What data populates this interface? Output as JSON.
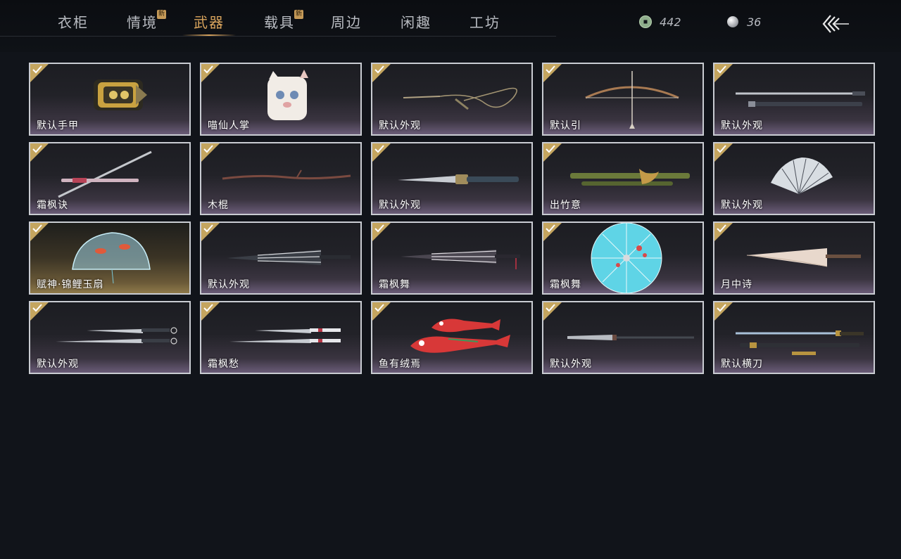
{
  "tabs": [
    {
      "label": "衣柜",
      "active": false,
      "badge": ""
    },
    {
      "label": "情境",
      "active": false,
      "badge": "新"
    },
    {
      "label": "武器",
      "active": true,
      "badge": ""
    },
    {
      "label": "载具",
      "active": false,
      "badge": "新"
    },
    {
      "label": "周边",
      "active": false,
      "badge": ""
    },
    {
      "label": "闲趣",
      "active": false,
      "badge": ""
    },
    {
      "label": "工坊",
      "active": false,
      "badge": ""
    }
  ],
  "currency": [
    {
      "icon": "jade-coin-icon",
      "value": "442"
    },
    {
      "icon": "pearl-icon",
      "value": "36"
    }
  ],
  "back_icon": "back-arrow-icon",
  "colors": {
    "accent": "#d9a45d",
    "check": "#c4a55f",
    "border": "#c9ccd2"
  },
  "items": [
    {
      "name": "默认手甲",
      "icon": "gauntlet-icon",
      "equipped": true
    },
    {
      "name": "喵仙人掌",
      "icon": "cat-paw-icon",
      "equipped": true
    },
    {
      "name": "默认外观",
      "icon": "rope-dart-icon",
      "equipped": true
    },
    {
      "name": "默认引",
      "icon": "bow-icon",
      "equipped": true
    },
    {
      "name": "默认外观",
      "icon": "sword-icon",
      "equipped": true
    },
    {
      "name": "霜枫诀",
      "icon": "spear-icon",
      "equipped": true
    },
    {
      "name": "木棍",
      "icon": "staff-icon",
      "equipped": true
    },
    {
      "name": "默认外观",
      "icon": "dagger-icon",
      "equipped": true
    },
    {
      "name": "出竹意",
      "icon": "bamboo-icon",
      "equipped": true
    },
    {
      "name": "默认外观",
      "icon": "fan-icon",
      "equipped": true
    },
    {
      "name": "赋神·锦鲤玉扇",
      "icon": "carp-fan-icon",
      "equipped": true
    },
    {
      "name": "默认外观",
      "icon": "closed-umbrella-icon",
      "equipped": true
    },
    {
      "name": "霜枫舞",
      "icon": "closed-umbrella-icon",
      "equipped": true
    },
    {
      "name": "霜枫舞",
      "icon": "open-umbrella-icon",
      "equipped": true
    },
    {
      "name": "月中诗",
      "icon": "parasol-icon",
      "equipped": true
    },
    {
      "name": "默认外观",
      "icon": "twin-blades-icon",
      "equipped": true
    },
    {
      "name": "霜枫愁",
      "icon": "twin-blades-icon",
      "equipped": true
    },
    {
      "name": "鱼有绒焉",
      "icon": "fish-blades-icon",
      "equipped": true
    },
    {
      "name": "默认外观",
      "icon": "glaive-icon",
      "equipped": true
    },
    {
      "name": "默认横刀",
      "icon": "long-sword-icon",
      "equipped": true
    }
  ]
}
